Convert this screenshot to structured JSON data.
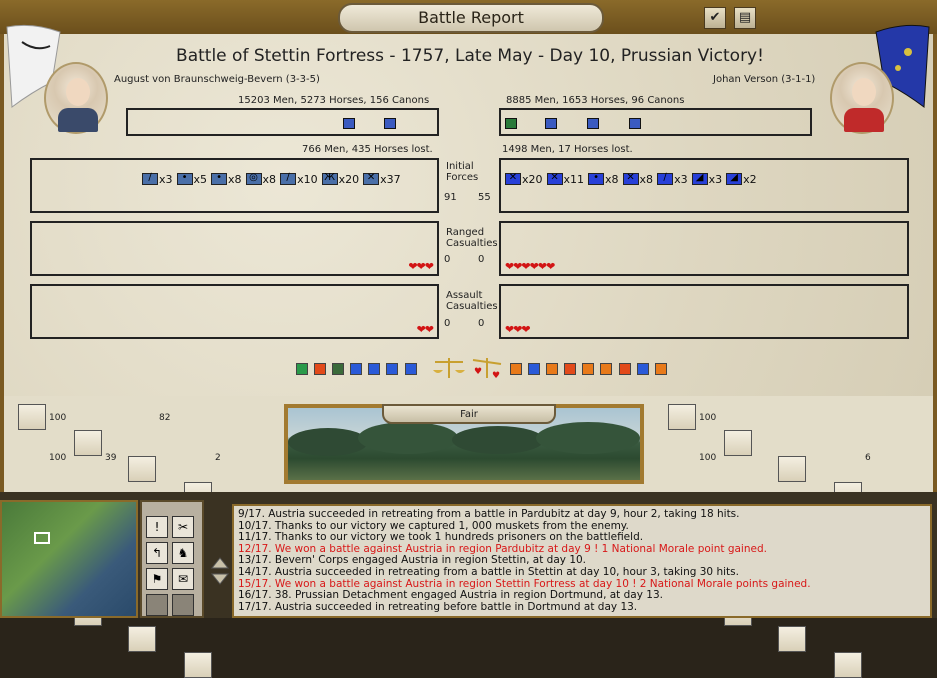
{
  "window": {
    "title": "Battle Report"
  },
  "battle": {
    "title": "Battle of Stettin Fortress - 1757, Late May - Day 10, Prussian Victory!",
    "left": {
      "commander": "August von Braunschweig-Bevern (3-3-5)",
      "forces": "15203 Men, 5273 Horses, 156 Canons",
      "losses": "766 Men, 435 Horses lost.",
      "units": [
        {
          "icon": "artillery-unit-icon",
          "glyph": "∕",
          "count": "x3"
        },
        {
          "icon": "infantry-unit-icon",
          "glyph": "•",
          "count": "x5"
        },
        {
          "icon": "infantry-unit-icon",
          "glyph": "•",
          "count": "x8"
        },
        {
          "icon": "supply-unit-icon",
          "glyph": "◎",
          "count": "x8"
        },
        {
          "icon": "cavalry-unit-icon",
          "glyph": "∕",
          "count": "x10"
        },
        {
          "icon": "militia-unit-icon",
          "glyph": "Ж",
          "count": "x20"
        },
        {
          "icon": "line-infantry-unit-icon",
          "glyph": "✕",
          "count": "x37"
        }
      ],
      "ranged_hearts": "❤❤❤",
      "assault_hearts": "❤❤",
      "initial_value": "91",
      "ranged_value": "0",
      "assault_value": "0"
    },
    "right": {
      "commander": "Johan Verson (3-1-1)",
      "forces": "8885 Men, 1653 Horses, 96 Canons",
      "losses": "1498 Men, 17 Horses lost.",
      "units": [
        {
          "icon": "line-infantry-unit-icon",
          "glyph": "✕",
          "count": "x20"
        },
        {
          "icon": "line-infantry-unit-icon",
          "glyph": "✕",
          "count": "x11"
        },
        {
          "icon": "infantry-unit-icon",
          "glyph": "•",
          "count": "x8"
        },
        {
          "icon": "line-infantry-unit-icon",
          "glyph": "✕",
          "count": "x8"
        },
        {
          "icon": "cavalry-unit-icon",
          "glyph": "∕",
          "count": "x3"
        },
        {
          "icon": "artillery-unit-icon",
          "glyph": "◢",
          "count": "x3"
        },
        {
          "icon": "artillery-unit-icon",
          "glyph": "◢",
          "count": "x2"
        }
      ],
      "ranged_hearts": "❤❤❤❤❤❤",
      "assault_hearts": "❤❤❤",
      "initial_value": "55",
      "ranged_value": "0",
      "assault_value": "0"
    },
    "labels": {
      "initial": "Initial Forces",
      "ranged": "Ranged Casualties",
      "assault": "Assault Casualties"
    }
  },
  "stats": {
    "left": {
      "r1": [
        "100",
        "",
        "82",
        "",
        ""
      ],
      "r2": [
        "100",
        "39",
        "",
        "2"
      ]
    },
    "right": {
      "r1": [
        "100",
        "",
        "",
        "",
        ""
      ],
      "r2": [
        "100",
        "",
        "",
        "6"
      ]
    }
  },
  "terrain": {
    "weather": "Fair"
  },
  "log": [
    {
      "text": "9/17.  Austria succeeded in retreating from a battle in Pardubitz at day 9, hour 2, taking 18 hits.",
      "red": false
    },
    {
      "text": "10/17. Thanks to our victory we captured 1, 000 muskets from the enemy.",
      "red": false
    },
    {
      "text": "11/17. Thanks to our victory we took 1 hundreds prisoners on the battlefield.",
      "red": false
    },
    {
      "text": "12/17. We won a battle against Austria in region Pardubitz at day 9 ! 1 National Morale point gained.",
      "red": true
    },
    {
      "text": "13/17. Bevern' Corps engaged Austria in region Stettin, at day 10.",
      "red": false
    },
    {
      "text": "14/17. Austria succeeded in retreating from a battle in Stettin at day 10, hour 3, taking 30 hits.",
      "red": false
    },
    {
      "text": "15/17. We won a battle against Austria in region Stettin Fortress at day 10 ! 2 National Morale points gained.",
      "red": true
    },
    {
      "text": "16/17. 38. Prussian Detachment engaged Austria in region Dortmund, at day 13.",
      "red": false
    },
    {
      "text": "17/17. Austria succeeded in retreating before battle in Dortmund at day 13.",
      "red": false
    }
  ],
  "commands": [
    "!",
    "✂",
    "↰",
    "♞",
    "⚑",
    "✉"
  ],
  "colors": {
    "prussian": "#4a6fa8",
    "austrian": "#2840d8",
    "hearts": "#d21414",
    "red_log": "#d81818"
  }
}
